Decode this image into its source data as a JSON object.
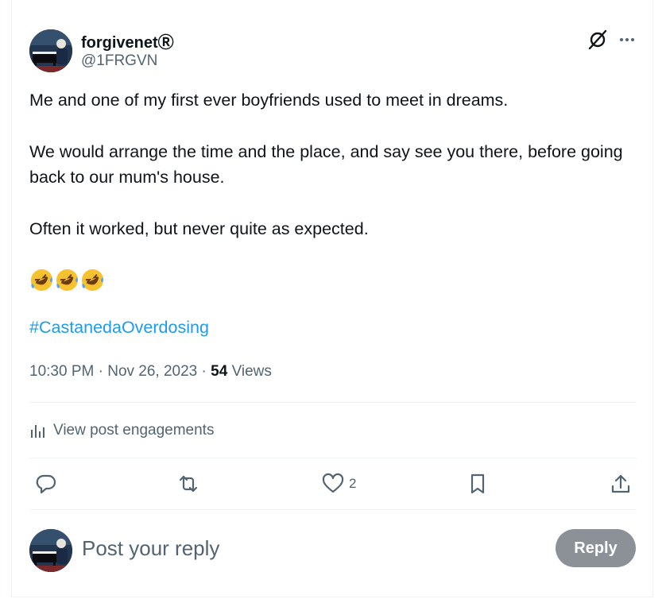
{
  "author": {
    "display_name": "forgivenetⓇ",
    "handle": "@1FRGVN",
    "avatar_icon": "avatar-pianist"
  },
  "header_icons": {
    "grok": "grok-icon",
    "more": "more-icon"
  },
  "post": {
    "paragraphs": [
      "Me and one of my first ever boyfriends used to meet in dreams.",
      "We would arrange the time and the place, and say see you there, before going back to our mum's house.",
      "Often it worked, but never quite as expected."
    ],
    "emojis": [
      "🤣",
      "🤣",
      "🤣"
    ],
    "hashtag": "#CastanedaOverdosing",
    "time": "10:30 PM",
    "date": "Nov 26, 2023",
    "separator": "·",
    "views_count": "54",
    "views_label": "Views"
  },
  "engagements": {
    "label": "View post engagements",
    "icon": "analytics-icon"
  },
  "actions": {
    "reply_icon": "reply-icon",
    "repost_icon": "repost-icon",
    "like_icon": "like-icon",
    "like_count": "2",
    "bookmark_icon": "bookmark-icon",
    "share_icon": "share-icon"
  },
  "reply_box": {
    "placeholder": "Post your reply",
    "button_label": "Reply"
  },
  "colors": {
    "link": "#1d9bf0",
    "secondary_text": "#536471",
    "primary_text": "#0f1419",
    "reply_button_disabled": "#8b9196",
    "divider": "#eff3f4"
  }
}
